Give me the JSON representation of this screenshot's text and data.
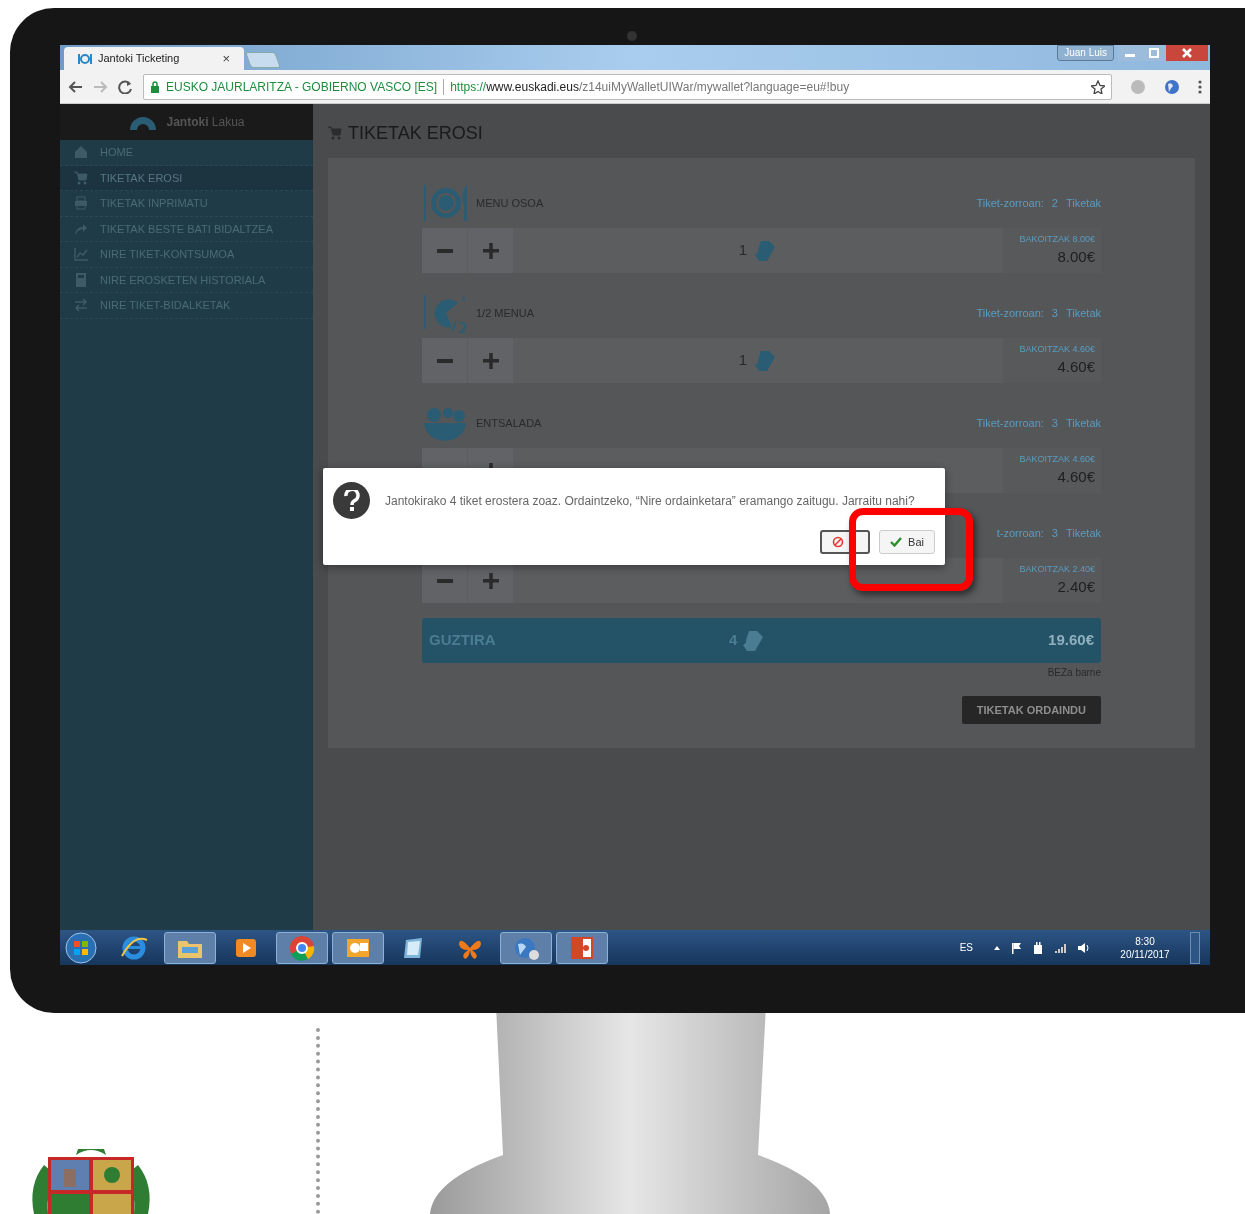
{
  "browser": {
    "tab_title": "Jantoki Ticketing",
    "tab_close": "×",
    "user": "Juan Luis",
    "site_identity": "EUSKO JAURLARITZA - GOBIERNO VASCO [ES]",
    "url_scheme": "https://",
    "url_host": "www.euskadi.eus",
    "url_path": "/z14uiMyWalletUIWar/mywallet?language=eu#!buy"
  },
  "app": {
    "brand_bold": "Jantoki",
    "brand_light": "Lakua"
  },
  "sidebar": {
    "items": [
      {
        "label": "HOME",
        "kind": "home",
        "selected": false
      },
      {
        "label": "TIKETAK EROSI",
        "kind": "cart",
        "selected": true
      },
      {
        "label": "TIKETAK INPRIMATU",
        "kind": "print",
        "selected": false
      },
      {
        "label": "TIKETAK BESTE BATI BIDALTZEA",
        "kind": "share",
        "selected": false
      },
      {
        "label": "NIRE TIKET-KONTSUMOA",
        "kind": "chart",
        "selected": false
      },
      {
        "label": "NIRE EROSKETEN HISTORIALA",
        "kind": "calculator",
        "selected": false
      },
      {
        "label": "NIRE TIKET-BIDALKETAK",
        "kind": "exchange",
        "selected": false
      }
    ]
  },
  "page_title": "TIKETAK EROSI",
  "items": [
    {
      "name": "MENU OSOA",
      "kind": "full",
      "wallet_label": "Tiket-zorroan:",
      "wallet_count": "2",
      "wallet_unit": "Tiketak",
      "quantity": "1",
      "unit_label": "BAKOITZAK",
      "unit_price": "8.00€",
      "price": "8.00€"
    },
    {
      "name": "1/2 MENUA",
      "kind": "half",
      "wallet_label": "Tiket-zorroan:",
      "wallet_count": "3",
      "wallet_unit": "Tiketak",
      "quantity": "1",
      "unit_label": "BAKOITZAK",
      "unit_price": "4.60€",
      "price": "4.60€"
    },
    {
      "name": "ENTSALADA",
      "kind": "salad",
      "wallet_label": "Tiket-zorroan:",
      "wallet_count": "3",
      "wallet_unit": "Tiketak",
      "unit_label": "BAKOITZAK",
      "unit_price": "4.60€",
      "price": "4.60€"
    },
    {
      "wallet_label": "t-zorroan:",
      "wallet_count": "3",
      "wallet_unit": "Tiketak",
      "unit_label": "BAKOITZAK",
      "unit_price": "2.40€",
      "price": "2.40€"
    }
  ],
  "total": {
    "label": "GUZTIRA",
    "count": "4",
    "amount": "19.60€"
  },
  "vat_note": "BEZa barne",
  "pay_button": "TIKETAK ORDAINDU",
  "dialog": {
    "message": "Jantokirako 4 tiket erostera zoaz. Ordaintzeko, “Nire ordainketara” eramango zaitugu. Jarraitu nahi?",
    "buttons": [
      {
        "kind": "cancel",
        "focused": true
      },
      {
        "kind": "confirm",
        "label": "Bai",
        "focused": false
      }
    ]
  },
  "taskbar": {
    "apps": [
      {
        "kind": "ie",
        "open": false
      },
      {
        "kind": "folder",
        "open": true
      },
      {
        "kind": "media",
        "open": false
      },
      {
        "kind": "chrome",
        "open": true
      },
      {
        "kind": "outlook",
        "open": true
      },
      {
        "kind": "book",
        "open": false
      },
      {
        "kind": "butterfly",
        "open": false
      },
      {
        "kind": "globe",
        "open": true
      },
      {
        "kind": "powerpoint",
        "open": true
      }
    ],
    "language": "ES",
    "time": "8:30",
    "date": "20/11/2017"
  }
}
